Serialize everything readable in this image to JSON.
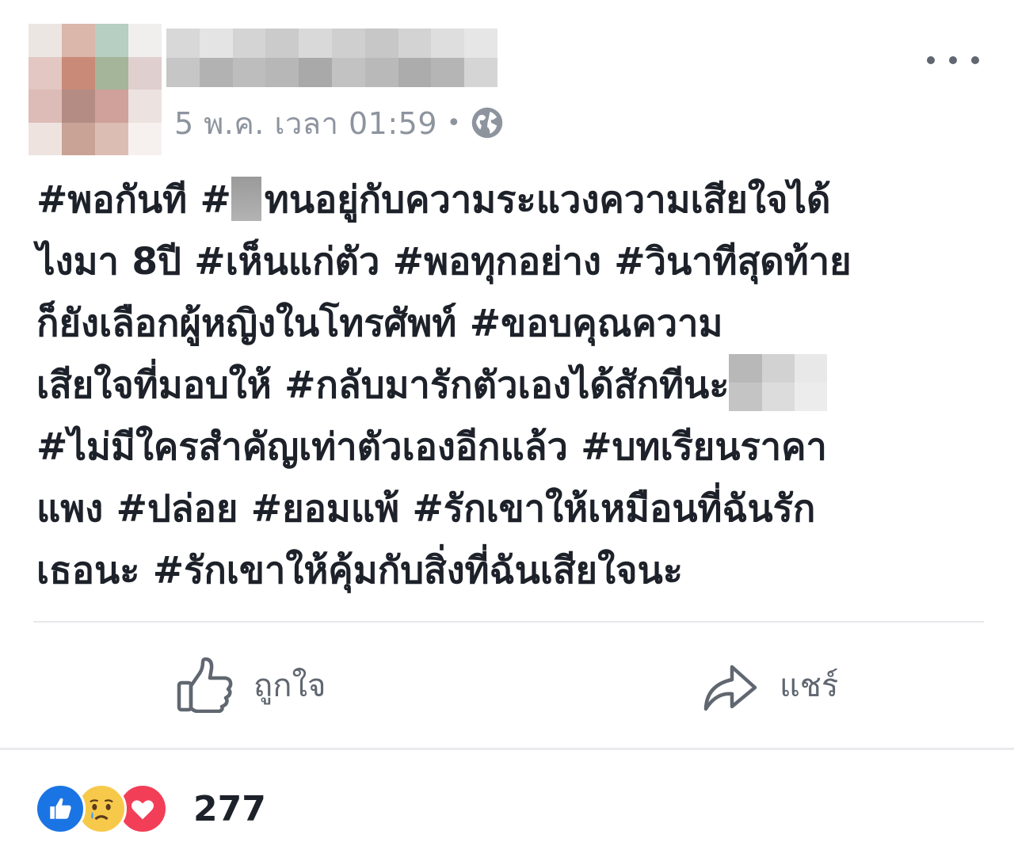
{
  "post": {
    "timestamp": "5 พ.ค. เวลา 01:59",
    "separator": "•",
    "privacy_icon": "globe-icon",
    "more_icon": "more-options-icon",
    "text_lines": [
      {
        "a": "#พอกันที #",
        "b": "ทนอยู่กับความระแวงความเสียใจได้"
      },
      {
        "a": "ไงมา 8ปี #เห็นแก่ตัว #พอทุกอย่าง #วินาทีสุดท้าย",
        "b": ""
      },
      {
        "a": "ก็ยังเลือกผู้หญิงในโทรศัพท์ #ขอบคุณความ",
        "b": ""
      },
      {
        "a": "เสียใจที่มอบให้ #กลับมารักตัวเองได้สักทีนะ",
        "b": ""
      },
      {
        "a": "#ไม่มีใครสำคัญเท่าตัวเองอีกแล้ว #บทเรียนราคา",
        "b": ""
      },
      {
        "a": "แพง #ปล่อย #ยอมแพ้ #รักเขาให้เหมือนที่ฉันรัก",
        "b": ""
      },
      {
        "a": "เธอนะ #รักเขาให้คุ้มกับสิ่งที่ฉันเสียใจนะ",
        "b": ""
      }
    ]
  },
  "actions": {
    "like_label": "ถูกใจ",
    "share_label": "แชร์"
  },
  "reactions": {
    "icons": [
      "like-reaction-icon",
      "sad-reaction-icon",
      "love-reaction-icon"
    ],
    "count": "277"
  },
  "colors": {
    "text": "#1d2129",
    "muted": "#8d949e",
    "action": "#606770",
    "like_blue": "#1b74e4",
    "sad_yellow": "#f7c94b",
    "love_red": "#f33e58"
  }
}
